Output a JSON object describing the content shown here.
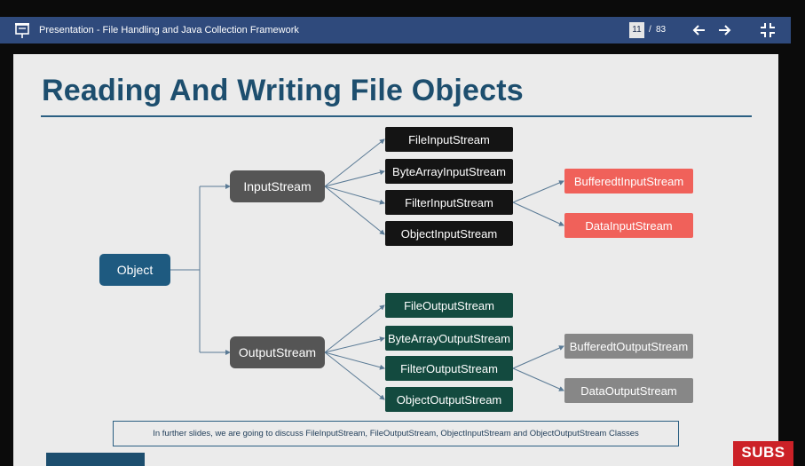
{
  "toolbar": {
    "title": "Presentation - File Handling and Java Collection Framework",
    "page_current": "11",
    "page_separator": "/",
    "page_total": "83",
    "icons": {
      "presentation": "presentation-icon",
      "prev": "arrow-left-icon",
      "next": "arrow-right-icon",
      "exit_fullscreen": "exit-fullscreen-icon"
    }
  },
  "slide": {
    "title": "Reading And Writing File Objects",
    "root": "Object",
    "input_stream": {
      "label": "InputStream",
      "children": [
        "FileInputStream",
        "ByteArrayInputStream",
        "FilterInputStream",
        "ObjectInputStream"
      ],
      "filter_children": [
        "BufferedtInputStream",
        "DataInputStream"
      ]
    },
    "output_stream": {
      "label": "OutputStream",
      "children": [
        "FileOutputStream",
        "ByteArrayOutputStream",
        "FilterOutputStream",
        "ObjectOutputStream"
      ],
      "filter_children": [
        "BufferedtOutputStream",
        "DataOutputStream"
      ]
    },
    "note": "In further slides, we are going to discuss FileInputStream, FileOutputStream, ObjectInputStream and ObjectOutputStream Classes"
  },
  "overlay": {
    "subscribe": "SUBS"
  },
  "colors": {
    "toolbar": "#2f4a7c",
    "title": "#1d4e6e",
    "object_box": "#1e5a80",
    "stream_box": "#555555",
    "input_child": "#141414",
    "output_child": "#134a3f",
    "input_filter_child": "#f0615a",
    "output_filter_child": "#878787",
    "subscribe": "#cc2127"
  }
}
